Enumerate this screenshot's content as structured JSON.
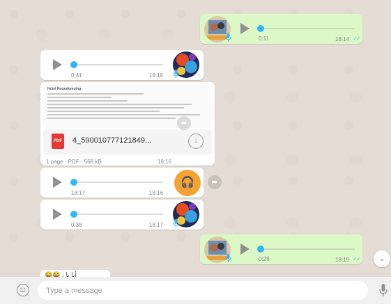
{
  "messages": {
    "out1": {
      "duration": "0:11",
      "time": "18:14",
      "status": "read"
    },
    "in1": {
      "duration": "0:41",
      "time": "18:16"
    },
    "doc": {
      "preview_header": "Hotel Housekeeping",
      "filename": "4_590010777121849...",
      "meta": "1 page · PDF · 568 kB",
      "badge": "PDF",
      "time": "18:16"
    },
    "in2": {
      "duration": "18:17",
      "time": "18:16"
    },
    "in3": {
      "duration": "0:38",
      "time": "18:17"
    },
    "out2": {
      "duration": "0:28",
      "time": "18:19",
      "status": "read"
    },
    "partial_text": "😂😂 ، أنا يا"
  },
  "composer": {
    "placeholder": "Type a message"
  },
  "colors": {
    "outgoing_bubble": "#dcf8c6",
    "incoming_bubble": "#ffffff",
    "accent_blue": "#30b6f6",
    "headphone_orange": "#f4a233",
    "pdf_red": "#e53935"
  },
  "icons": {
    "play": "play-icon",
    "mic": "mic-icon",
    "download": "download-icon",
    "share": "share-icon",
    "headphones": "headphones-icon",
    "emoji": "emoji-icon",
    "scroll_down": "chevron-down-icon"
  }
}
